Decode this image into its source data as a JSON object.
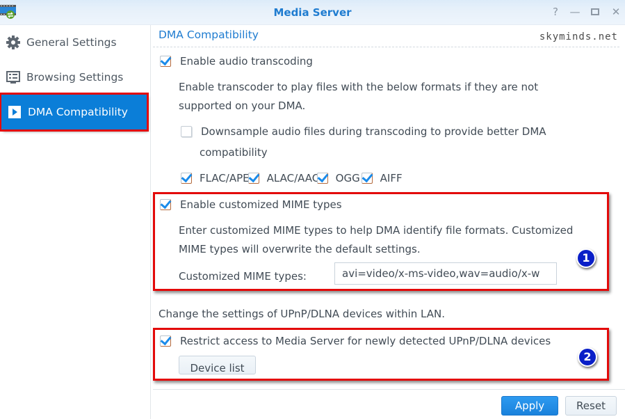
{
  "window": {
    "title": "Media Server",
    "controls": {
      "help": "?",
      "minimize": "—",
      "maximize": "▭",
      "close": "✕"
    }
  },
  "sidebar": {
    "items": [
      {
        "label": "General Settings",
        "icon": "gear-icon",
        "active": false
      },
      {
        "label": "Browsing Settings",
        "icon": "browse-list-icon",
        "active": false
      },
      {
        "label": "DMA Compatibility",
        "icon": "play-icon",
        "active": true
      }
    ]
  },
  "main": {
    "section_title": "DMA Compatibility",
    "watermark": "skyminds.net",
    "audio_transcoding": {
      "label": "Enable audio transcoding",
      "checked": true,
      "description_line1": "Enable transcoder to play files with the below formats if they are not",
      "description_line2": "supported on your DMA.",
      "downsample": {
        "label_line1": "Downsample audio files during transcoding to provide better DMA",
        "label_line2": "compatibility",
        "checked": false
      },
      "formats": [
        {
          "label": "FLAC/APE",
          "checked": true
        },
        {
          "label": "ALAC/AAC",
          "checked": true
        },
        {
          "label": "OGG",
          "checked": true
        },
        {
          "label": "AIFF",
          "checked": true
        }
      ]
    },
    "mime": {
      "label": "Enable customized MIME types",
      "checked": true,
      "description_line1": "Enter customized MIME types to help DMA identify file formats. Customized",
      "description_line2": "MIME types will overwrite the default settings.",
      "field_label": "Customized MIME types:",
      "field_value": "avi=video/x-ms-video,wav=audio/x-w",
      "annotation": "1"
    },
    "upnp": {
      "description": "Change the settings of UPnP/DLNA devices within LAN.",
      "restrict_label": "Restrict access to Media Server for newly detected UPnP/DLNA devices",
      "restrict_checked": true,
      "device_list_button": "Device list",
      "annotation": "2"
    },
    "footer": {
      "apply": "Apply",
      "reset": "Reset"
    }
  },
  "colors": {
    "accent": "#1f7cd0",
    "active_nav": "#0b7ed8",
    "annotation_red": "#e30a0a",
    "badge_blue": "#0a1fc8"
  }
}
